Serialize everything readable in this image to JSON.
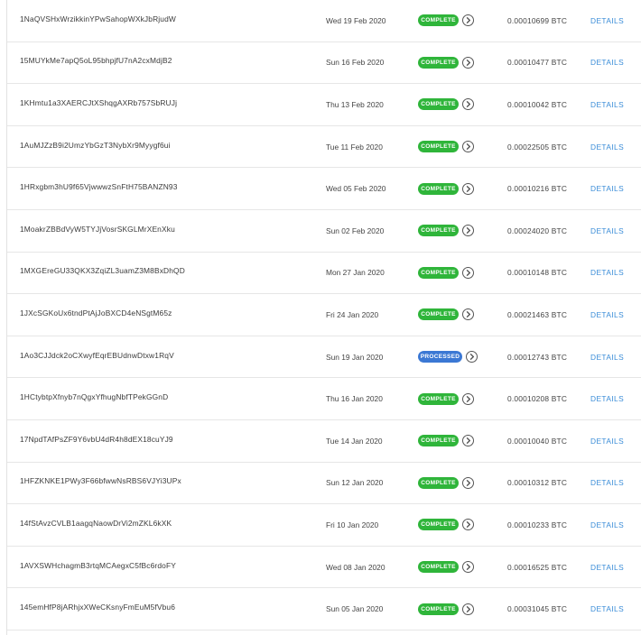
{
  "transactions": [
    {
      "address": "1NaQVSHxWrzikkinYPwSahopWXkJbRjudW",
      "date": "Wed 19 Feb 2020",
      "status": "COMPLETE",
      "amount": "0.00010699 BTC",
      "details": "DETAILS"
    },
    {
      "address": "15MUYkMe7apQ5oL95bhpjfU7nA2cxMdjB2",
      "date": "Sun 16 Feb 2020",
      "status": "COMPLETE",
      "amount": "0.00010477 BTC",
      "details": "DETAILS"
    },
    {
      "address": "1KHmtu1a3XAERCJtXShqgAXRb757SbRUJj",
      "date": "Thu 13 Feb 2020",
      "status": "COMPLETE",
      "amount": "0.00010042 BTC",
      "details": "DETAILS"
    },
    {
      "address": "1AuMJZzB9i2UmzYbGzT3NybXr9Myygf6ui",
      "date": "Tue 11 Feb 2020",
      "status": "COMPLETE",
      "amount": "0.00022505 BTC",
      "details": "DETAILS"
    },
    {
      "address": "1HRxgbm3hU9f65VjwwwzSnFtH75BANZN93",
      "date": "Wed 05 Feb 2020",
      "status": "COMPLETE",
      "amount": "0.00010216 BTC",
      "details": "DETAILS"
    },
    {
      "address": "1MoakrZBBdVyW5TYJjVosrSKGLMrXEnXku",
      "date": "Sun 02 Feb 2020",
      "status": "COMPLETE",
      "amount": "0.00024020 BTC",
      "details": "DETAILS"
    },
    {
      "address": "1MXGEreGU33QKX3ZqiZL3uamZ3M8BxDhQD",
      "date": "Mon 27 Jan 2020",
      "status": "COMPLETE",
      "amount": "0.00010148 BTC",
      "details": "DETAILS"
    },
    {
      "address": "1JXcSGKoUx6tndPtAjJoBXCD4eNSgtM65z",
      "date": "Fri 24 Jan 2020",
      "status": "COMPLETE",
      "amount": "0.00021463 BTC",
      "details": "DETAILS"
    },
    {
      "address": "1Ao3CJJdck2oCXwyfEqrEBUdnwDtxw1RqV",
      "date": "Sun 19 Jan 2020",
      "status": "PROCESSED",
      "amount": "0.00012743 BTC",
      "details": "DETAILS"
    },
    {
      "address": "1HCtybtpXfnyb7nQgxYfhugNbfTPekGGnD",
      "date": "Thu 16 Jan 2020",
      "status": "COMPLETE",
      "amount": "0.00010208 BTC",
      "details": "DETAILS"
    },
    {
      "address": "17NpdTAfPsZF9Y6vbU4dR4h8dEX18cuYJ9",
      "date": "Tue 14 Jan 2020",
      "status": "COMPLETE",
      "amount": "0.00010040 BTC",
      "details": "DETAILS"
    },
    {
      "address": "1HFZKNKE1PWy3F66bfwwNsRBS6VJYi3UPx",
      "date": "Sun 12 Jan 2020",
      "status": "COMPLETE",
      "amount": "0.00010312 BTC",
      "details": "DETAILS"
    },
    {
      "address": "14fStAvzCVLB1aagqNaowDrVi2mZKL6kXK",
      "date": "Fri 10 Jan 2020",
      "status": "COMPLETE",
      "amount": "0.00010233 BTC",
      "details": "DETAILS"
    },
    {
      "address": "1AVXSWHchagmB3rtqMCAegxC5fBc6rdoFY",
      "date": "Wed 08 Jan 2020",
      "status": "COMPLETE",
      "amount": "0.00016525 BTC",
      "details": "DETAILS"
    },
    {
      "address": "145emHfP8jARhjxXWeCKsnyFmEuM5fVbu6",
      "date": "Sun 05 Jan 2020",
      "status": "COMPLETE",
      "amount": "0.00031045 BTC",
      "details": "DETAILS"
    }
  ],
  "icons": {
    "status_arrow": "chevron-right-circle-icon"
  },
  "colors": {
    "complete": "#2fb53a",
    "processed": "#3b78d4",
    "link": "#3b8dd8",
    "divider": "#e6e6e6"
  }
}
